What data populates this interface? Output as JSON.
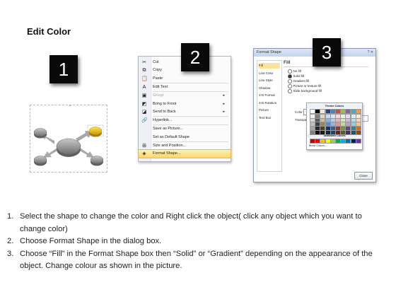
{
  "title": "Edit Color",
  "steps": {
    "one": "1",
    "two": "2",
    "three": "3"
  },
  "context_menu": {
    "items": [
      {
        "label": "Cut",
        "icon": "scissors-icon",
        "glyph": "✂",
        "enabled": true
      },
      {
        "label": "Copy",
        "icon": "copy-icon",
        "glyph": "⧉",
        "enabled": true
      },
      {
        "label": "Paste",
        "icon": "paste-icon",
        "glyph": "📋",
        "enabled": true
      },
      {
        "label": "Edit Text",
        "icon": "edit-text-icon",
        "glyph": "A",
        "enabled": true
      },
      {
        "label": "Group",
        "icon": "group-icon",
        "glyph": "▣",
        "enabled": false,
        "submenu": true
      },
      {
        "label": "Bring to Front",
        "icon": "bring-front-icon",
        "glyph": "◩",
        "enabled": true,
        "submenu": true
      },
      {
        "label": "Send to Back",
        "icon": "send-back-icon",
        "glyph": "◪",
        "enabled": true,
        "submenu": true
      },
      {
        "label": "Hyperlink...",
        "icon": "hyperlink-icon",
        "glyph": "🔗",
        "enabled": true
      },
      {
        "label": "Save as Picture...",
        "icon": "",
        "glyph": "",
        "enabled": true
      },
      {
        "label": "Set as Default Shape",
        "icon": "",
        "glyph": "",
        "enabled": true
      },
      {
        "label": "Size and Position...",
        "icon": "size-position-icon",
        "glyph": "⊞",
        "enabled": true
      },
      {
        "label": "Format Shape...",
        "icon": "format-shape-icon",
        "glyph": "◈",
        "enabled": true,
        "highlighted": true
      }
    ]
  },
  "format_dialog": {
    "title": "Format Shape",
    "window_buttons": "? ✕",
    "categories": [
      "Fill",
      "Line Color",
      "Line Style",
      "Shadow",
      "3-D Format",
      "3-D Rotation",
      "Picture",
      "Text Box"
    ],
    "section_heading": "Fill",
    "fill_options": [
      {
        "label": "No fill",
        "selected": false
      },
      {
        "label": "Solid fill",
        "selected": true
      },
      {
        "label": "Gradient fill",
        "selected": false
      },
      {
        "label": "Picture or texture fill",
        "selected": false
      },
      {
        "label": "Slide background fill",
        "selected": false
      }
    ],
    "color_label": "Color:",
    "transparency_label": "Transpa",
    "palette": {
      "theme_heading": "Theme Colors",
      "standard_heading": "Standard Colors",
      "more_label": "More Colors...",
      "theme_colors": [
        [
          "#ffffff",
          "#000000",
          "#eeece1",
          "#1f497d",
          "#4f81bd",
          "#c0504d",
          "#9bbb59",
          "#8064a2",
          "#4bacc6",
          "#f79646"
        ],
        [
          "#f2f2f2",
          "#7f7f7f",
          "#ddd9c3",
          "#c6d9f0",
          "#dbe5f1",
          "#f2dcdb",
          "#ebf1dd",
          "#e5e0ec",
          "#dbeef3",
          "#fdeada"
        ],
        [
          "#d8d8d8",
          "#595959",
          "#c4bd97",
          "#8db3e2",
          "#b8cce4",
          "#e5b9b7",
          "#d7e3bc",
          "#ccc1d9",
          "#b7dde8",
          "#fbd5b5"
        ],
        [
          "#bfbfbf",
          "#3f3f3f",
          "#938953",
          "#548dd4",
          "#95b3d7",
          "#d99694",
          "#c3d69b",
          "#b2a2c7",
          "#92cddc",
          "#fac08f"
        ],
        [
          "#a5a5a5",
          "#262626",
          "#494429",
          "#17365d",
          "#366092",
          "#953734",
          "#76923c",
          "#5f497a",
          "#31859b",
          "#e36c09"
        ],
        [
          "#7f7f7f",
          "#0c0c0c",
          "#1d1b10",
          "#0f243e",
          "#244061",
          "#632423",
          "#4f6128",
          "#3f3151",
          "#205867",
          "#974806"
        ]
      ],
      "standard_colors": [
        "#c00000",
        "#ff0000",
        "#ffc000",
        "#ffff00",
        "#92d050",
        "#00b050",
        "#00b0f0",
        "#0070c0",
        "#002060",
        "#7030a0"
      ]
    },
    "close_label": "Close"
  },
  "colors": {
    "selected_shape": "#e8c21a",
    "shape_gray": "#8e8e8e",
    "menu_highlight": "#f9d76a",
    "badge": "#0a0a0a"
  },
  "instructions": [
    {
      "n": "1.",
      "text": "Select the shape to change the color and Right click the object( click any object which you want to change color)"
    },
    {
      "n": "2.",
      "text": "Choose Format Shape in the dialog box."
    },
    {
      "n": "3.",
      "text": "Choose “Fill” in the Format Shape box then “Solid” or “Gradient” depending on the appearance of the object. Change colour as shown in the picture."
    }
  ]
}
